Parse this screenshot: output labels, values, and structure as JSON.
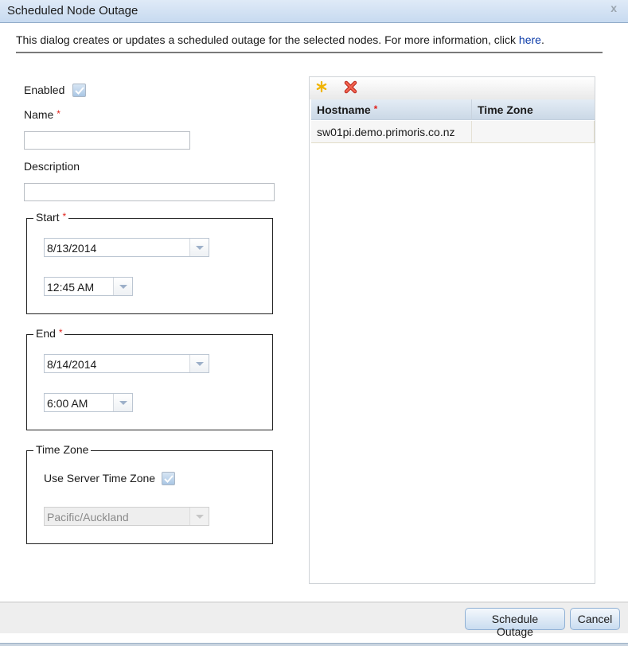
{
  "dialog": {
    "title": "Scheduled Node Outage",
    "close_label": "x",
    "intro_text": "This dialog creates or updates a scheduled outage for the selected nodes. For more information, click ",
    "intro_link": "here",
    "intro_suffix": "."
  },
  "form": {
    "enabled_label": "Enabled",
    "enabled_checked": true,
    "name_label": "Name",
    "name_value": "",
    "description_label": "Description",
    "description_value": "",
    "required_marker": "*",
    "start": {
      "legend": "Start",
      "date": "8/13/2014",
      "time": "12:45 AM"
    },
    "end": {
      "legend": "End",
      "date": "8/14/2014",
      "time": "6:00 AM"
    },
    "timezone": {
      "legend": "Time Zone",
      "use_server_label": "Use Server Time Zone",
      "use_server_checked": true,
      "zone": "Pacific/Auckland",
      "zone_disabled": true
    }
  },
  "grid": {
    "toolbar": {
      "add_icon": "asterisk-add-icon",
      "delete_icon": "red-x-delete-icon"
    },
    "columns": [
      {
        "label": "Hostname",
        "required": true
      },
      {
        "label": "Time Zone",
        "required": false
      }
    ],
    "rows": [
      {
        "hostname": "sw01pi.demo.primoris.co.nz",
        "timezone": ""
      }
    ]
  },
  "footer": {
    "schedule_label": "Schedule Outage",
    "cancel_label": "Cancel"
  },
  "colors": {
    "link": "#0a3aa8",
    "required": "#e0201a",
    "title_bar": "#c7daf0"
  }
}
